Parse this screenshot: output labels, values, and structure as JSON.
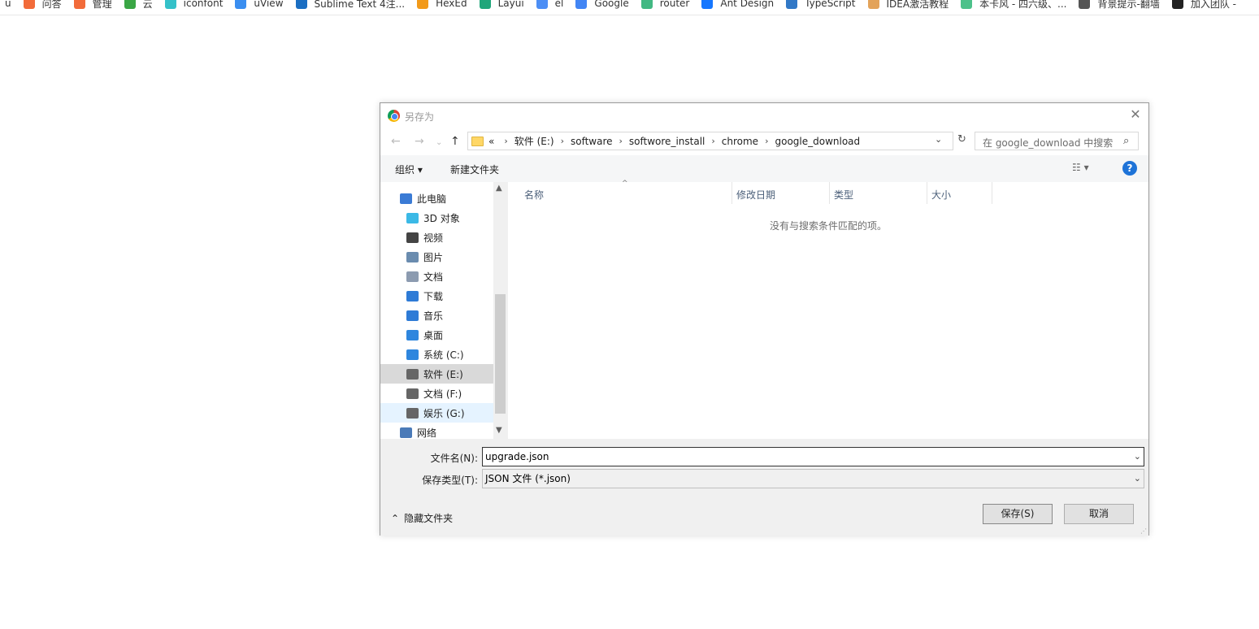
{
  "bookmarks": [
    {
      "label": "u",
      "color": "#ffffff"
    },
    {
      "label": "问答",
      "color": "#f26b3a"
    },
    {
      "label": "管理",
      "color": "#f26b3a"
    },
    {
      "label": "云",
      "color": "#3aa645"
    },
    {
      "label": "iconfont",
      "color": "#35c1c9"
    },
    {
      "label": "uView",
      "color": "#3a8ef0"
    },
    {
      "label": "Sublime Text 4注...",
      "color": "#1b6ec2"
    },
    {
      "label": "HexEd",
      "color": "#f29a1a"
    },
    {
      "label": "Layui",
      "color": "#1fa67a"
    },
    {
      "label": "el",
      "color": "#4c8ef5"
    },
    {
      "label": "Google",
      "color": "#4285f4"
    },
    {
      "label": "router",
      "color": "#42b883"
    },
    {
      "label": "Ant Design",
      "color": "#1677ff"
    },
    {
      "label": "TypeScript",
      "color": "#3178c6"
    },
    {
      "label": "IDEA激活教程",
      "color": "#e3a35a"
    },
    {
      "label": "本卡风 - 四六级、...",
      "color": "#4cc18a"
    },
    {
      "label": "背景提示-翻墙",
      "color": "#555555"
    },
    {
      "label": "加入团队 -",
      "color": "#222222"
    }
  ],
  "dialog": {
    "title": "另存为",
    "close": "✕",
    "breadcrumb": [
      "«",
      "软件 (E:)",
      "software",
      "softwore_install",
      "chrome",
      "google_download"
    ],
    "search_placeholder": "在 google_download 中搜索",
    "toolbar": {
      "organize": "组织 ▾",
      "new_folder": "新建文件夹",
      "help": "?"
    },
    "nav": [
      {
        "label": "此电脑",
        "icon": "computer-icon",
        "color": "#3a7bd5",
        "state": ""
      },
      {
        "label": "3D 对象",
        "icon": "cube-icon",
        "color": "#3bb9e6",
        "state": ""
      },
      {
        "label": "视频",
        "icon": "film-icon",
        "color": "#444444",
        "state": ""
      },
      {
        "label": "图片",
        "icon": "picture-icon",
        "color": "#6a8caf",
        "state": ""
      },
      {
        "label": "文档",
        "icon": "document-icon",
        "color": "#8c9bb0",
        "state": ""
      },
      {
        "label": "下载",
        "icon": "download-icon",
        "color": "#2e7bd6",
        "state": ""
      },
      {
        "label": "音乐",
        "icon": "music-icon",
        "color": "#2e7bd6",
        "state": ""
      },
      {
        "label": "桌面",
        "icon": "desktop-icon",
        "color": "#2e86de",
        "state": ""
      },
      {
        "label": "系统 (C:)",
        "icon": "windows-drive-icon",
        "color": "#2e86de",
        "state": ""
      },
      {
        "label": "软件 (E:)",
        "icon": "drive-icon",
        "color": "#666666",
        "state": "sel"
      },
      {
        "label": "文档 (F:)",
        "icon": "drive-icon",
        "color": "#666666",
        "state": ""
      },
      {
        "label": "娱乐 (G:)",
        "icon": "drive-icon",
        "color": "#666666",
        "state": "hover"
      },
      {
        "label": "网络",
        "icon": "network-icon",
        "color": "#4a7ab8",
        "state": ""
      }
    ],
    "columns": [
      "名称",
      "修改日期",
      "类型",
      "大小"
    ],
    "empty_message": "没有与搜索条件匹配的项。",
    "filename_label": "文件名(N):",
    "filename_value": "upgrade.json",
    "filetype_label": "保存类型(T):",
    "filetype_value": "JSON 文件 (*.json)",
    "hide_folders": "隐藏文件夹",
    "save_button": "保存(S)",
    "cancel_button": "取消"
  }
}
